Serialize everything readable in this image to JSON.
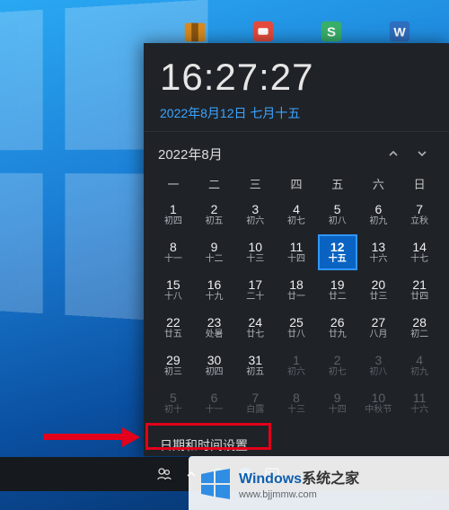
{
  "desktop_icons": [
    "archive-icon",
    "pdf-icon",
    "spreadsheet-icon",
    "doc-icon"
  ],
  "clock": {
    "time": "16:27:27",
    "date_line": "2022年8月12日 七月十五"
  },
  "calendar": {
    "month_label": "2022年8月",
    "dow": [
      "一",
      "二",
      "三",
      "四",
      "五",
      "六",
      "日"
    ],
    "today": {
      "week": 2,
      "col": 5
    },
    "weeks": [
      [
        {
          "n": "1",
          "s": "初四"
        },
        {
          "n": "2",
          "s": "初五"
        },
        {
          "n": "3",
          "s": "初六"
        },
        {
          "n": "4",
          "s": "初七"
        },
        {
          "n": "5",
          "s": "初八"
        },
        {
          "n": "6",
          "s": "初九"
        },
        {
          "n": "7",
          "s": "立秋"
        }
      ],
      [
        {
          "n": "8",
          "s": "十一"
        },
        {
          "n": "9",
          "s": "十二"
        },
        {
          "n": "10",
          "s": "十三"
        },
        {
          "n": "11",
          "s": "十四"
        },
        {
          "n": "12",
          "s": "十五"
        },
        {
          "n": "13",
          "s": "十六"
        },
        {
          "n": "14",
          "s": "十七"
        }
      ],
      [
        {
          "n": "15",
          "s": "十八"
        },
        {
          "n": "16",
          "s": "十九"
        },
        {
          "n": "17",
          "s": "二十"
        },
        {
          "n": "18",
          "s": "廿一"
        },
        {
          "n": "19",
          "s": "廿二"
        },
        {
          "n": "20",
          "s": "廿三"
        },
        {
          "n": "21",
          "s": "廿四"
        }
      ],
      [
        {
          "n": "22",
          "s": "廿五"
        },
        {
          "n": "23",
          "s": "处暑"
        },
        {
          "n": "24",
          "s": "廿七"
        },
        {
          "n": "25",
          "s": "廿八"
        },
        {
          "n": "26",
          "s": "廿九"
        },
        {
          "n": "27",
          "s": "八月"
        },
        {
          "n": "28",
          "s": "初二"
        }
      ],
      [
        {
          "n": "29",
          "s": "初三"
        },
        {
          "n": "30",
          "s": "初四"
        },
        {
          "n": "31",
          "s": "初五"
        },
        {
          "n": "1",
          "s": "初六",
          "other": true
        },
        {
          "n": "2",
          "s": "初七",
          "other": true
        },
        {
          "n": "3",
          "s": "初八",
          "other": true
        },
        {
          "n": "4",
          "s": "初九",
          "other": true
        }
      ],
      [
        {
          "n": "5",
          "s": "初十",
          "other": true
        },
        {
          "n": "6",
          "s": "十一",
          "other": true
        },
        {
          "n": "7",
          "s": "白露",
          "other": true
        },
        {
          "n": "8",
          "s": "十三",
          "other": true
        },
        {
          "n": "9",
          "s": "十四",
          "other": true
        },
        {
          "n": "10",
          "s": "中秋节",
          "other": true
        },
        {
          "n": "11",
          "s": "十六",
          "other": true
        }
      ]
    ],
    "link_label": "日期和时间设置"
  },
  "tray_icons": [
    "people-icon",
    "chevron-up-icon",
    "shield-green-icon",
    "shield-blue-icon",
    "ime-icon"
  ],
  "watermark": {
    "brand_en": "Windows",
    "brand_cn": "系统之家",
    "url": "www.bjjmmw.com"
  },
  "icon_colors": {
    "archive": "#d98b1e",
    "pdf": "#e54b3c",
    "spreadsheet": "#38b06a",
    "doc": "#2f6fbf"
  }
}
